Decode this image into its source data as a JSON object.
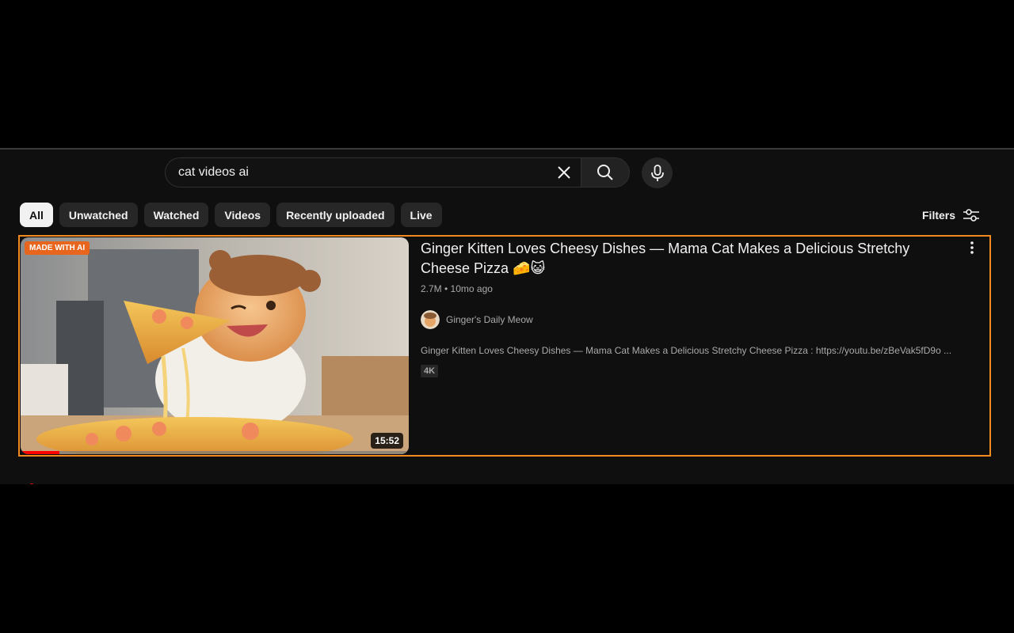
{
  "search": {
    "value": "cat videos ai",
    "clear_icon": "close-icon",
    "search_icon": "search-icon",
    "mic_icon": "mic-icon"
  },
  "chips": [
    {
      "label": "All",
      "active": true
    },
    {
      "label": "Unwatched",
      "active": false
    },
    {
      "label": "Watched",
      "active": false
    },
    {
      "label": "Videos",
      "active": false
    },
    {
      "label": "Recently uploaded",
      "active": false
    },
    {
      "label": "Live",
      "active": false
    }
  ],
  "filters": {
    "label": "Filters",
    "icon": "sliders-icon"
  },
  "result": {
    "badge": "MADE WITH AI",
    "duration": "15:52",
    "watched_progress_pct": 10,
    "title": "Ginger Kitten Loves Cheesy Dishes — Mama Cat Makes a Delicious Stretchy Cheese Pizza 🧀😺",
    "meta": "2.7M • 10mo ago",
    "channel": "Ginger's Daily Meow",
    "description": "Ginger Kitten Loves Cheesy Dishes — Mama Cat Makes a Delicious Stretchy Cheese Pizza : https://youtu.be/zBeVak5fD9o ...",
    "quality_badge": "4K",
    "menu_icon": "more-vert-icon"
  },
  "colors": {
    "accent_outline": "#f28a1f",
    "ai_badge": "#e8651d",
    "progress": "#ff0000",
    "background": "#0f0f0f"
  }
}
